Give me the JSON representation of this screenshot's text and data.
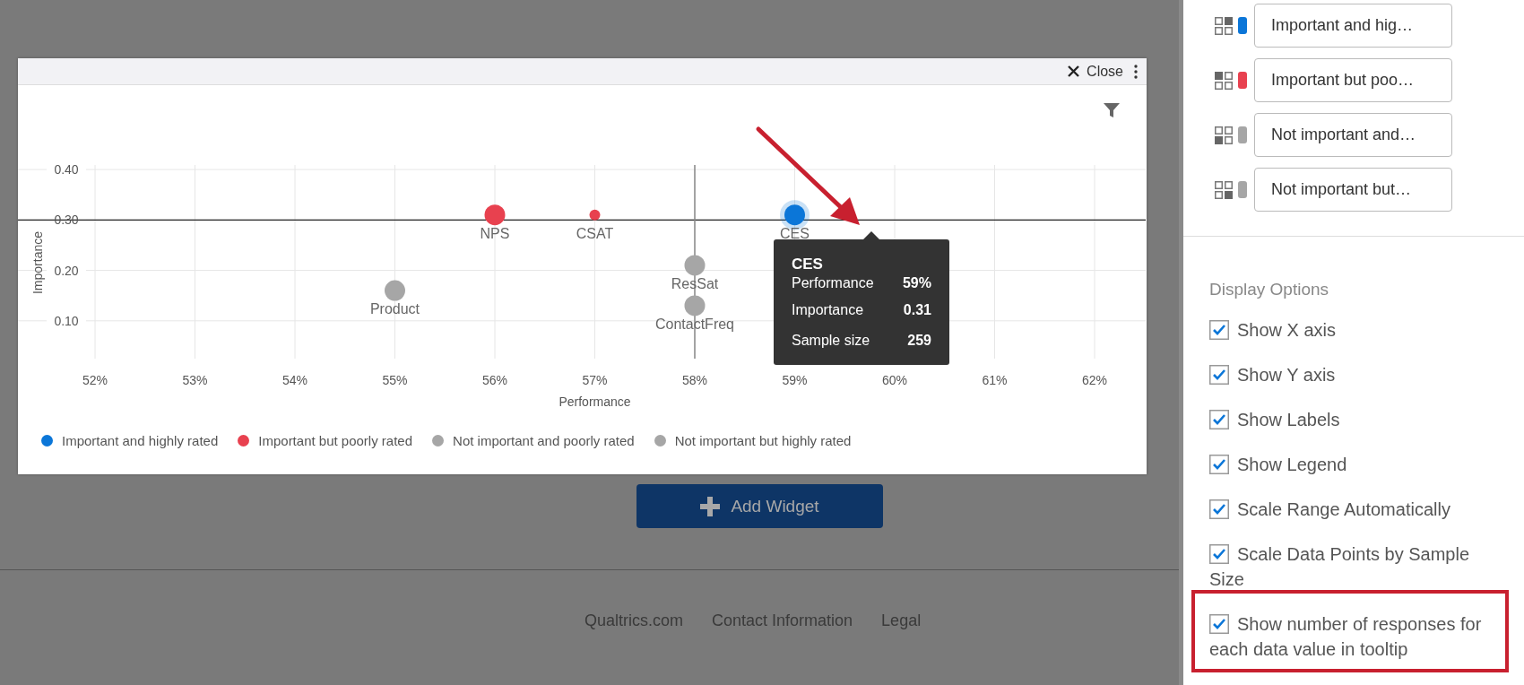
{
  "modal": {
    "close_label": "Close",
    "chart": {
      "chart_data": {
        "type": "scatter",
        "xlabel": "Performance",
        "ylabel": "Importance",
        "grid": true,
        "xlim": [
          52,
          62
        ],
        "ylim": [
          0.025,
          0.409
        ],
        "xticks": [
          {
            "value": 52,
            "label": "52%"
          },
          {
            "value": 53,
            "label": "53%"
          },
          {
            "value": 54,
            "label": "54%"
          },
          {
            "value": 55,
            "label": "55%"
          },
          {
            "value": 56,
            "label": "56%"
          },
          {
            "value": 57,
            "label": "57%"
          },
          {
            "value": 58,
            "label": "58%"
          },
          {
            "value": 59,
            "label": "59%"
          },
          {
            "value": 60,
            "label": "60%"
          },
          {
            "value": 61,
            "label": "61%"
          },
          {
            "value": 62,
            "label": "62%"
          }
        ],
        "yticks": [
          {
            "value": 0.1,
            "label": "0.10"
          },
          {
            "value": 0.2,
            "label": "0.20"
          },
          {
            "value": 0.3,
            "label": "0.30"
          },
          {
            "value": 0.4,
            "label": "0.40"
          }
        ],
        "x": [
          55,
          56,
          57,
          58,
          58,
          59
        ],
        "series": [
          {
            "name": "Important and highly rated",
            "color": "#0b76d8",
            "values": [
              null,
              null,
              null,
              null,
              null,
              0.31
            ]
          },
          {
            "name": "Important but poorly rated",
            "color": "#e8414f",
            "values": [
              null,
              0.31,
              0.31,
              null,
              null,
              null
            ]
          },
          {
            "name": "Not important and poorly rated",
            "color": "#a6a6a6",
            "values": [
              0.16,
              null,
              null,
              0.21,
              0.13,
              null
            ]
          },
          {
            "name": "Not important but highly rated",
            "color": "#a6a6a6",
            "values": [
              null,
              null,
              null,
              null,
              null,
              null
            ]
          }
        ],
        "ref_lines": [
          {
            "axis": "y",
            "value": 0.3
          },
          {
            "axis": "x",
            "value": 58
          }
        ],
        "annotations": [
          {
            "text": "Product",
            "x": 55,
            "y": 0.16
          },
          {
            "text": "NPS",
            "x": 56,
            "y": 0.31
          },
          {
            "text": "CSAT",
            "x": 57,
            "y": 0.31
          },
          {
            "text": "ResSat",
            "x": 58,
            "y": 0.21
          },
          {
            "text": "ContactFreq",
            "x": 58,
            "y": 0.13
          },
          {
            "text": "CES",
            "x": 59,
            "y": 0.31
          }
        ]
      },
      "markers": [
        {
          "kind": "large",
          "highlighted": false
        },
        {
          "kind": "large",
          "highlighted": false
        },
        {
          "kind": "small",
          "highlighted": false
        },
        {
          "kind": "large",
          "highlighted": false
        },
        {
          "kind": "large",
          "highlighted": false
        },
        {
          "kind": "large",
          "highlighted": true
        }
      ],
      "tooltip": {
        "title": "CES",
        "rows": [
          {
            "label": "Performance",
            "value": "59%"
          },
          {
            "label": "Importance",
            "value": "0.31"
          },
          {
            "label": "Sample size",
            "value": "259"
          }
        ]
      }
    }
  },
  "add_widget": {
    "label": "Add Widget"
  },
  "footer": {
    "links": [
      "Qualtrics.com",
      "Contact Information",
      "Legal"
    ]
  },
  "panel": {
    "quadrants": [
      {
        "kind": "topright",
        "color": "#0b76d8",
        "value": "Important and hig…"
      },
      {
        "kind": "topleft",
        "color": "#e8414f",
        "value": "Important but poo…"
      },
      {
        "kind": "bottomleft",
        "color": "#a6a6a6",
        "value": "Not important and…"
      },
      {
        "kind": "bottomright",
        "color": "#a6a6a6",
        "value": "Not important but…"
      }
    ],
    "display_options": {
      "title": "Display Options",
      "options": [
        {
          "label": "Show X axis",
          "checked": true
        },
        {
          "label": "Show Y axis",
          "checked": true
        },
        {
          "label": "Show Labels",
          "checked": true
        },
        {
          "label": "Show Legend",
          "checked": true
        },
        {
          "label": "Scale Range Automatically",
          "checked": true
        },
        {
          "label": "Scale Data Points by Sample Size",
          "checked": true
        },
        {
          "label": "Show number of responses for each data value in tooltip",
          "checked": true
        }
      ]
    }
  }
}
